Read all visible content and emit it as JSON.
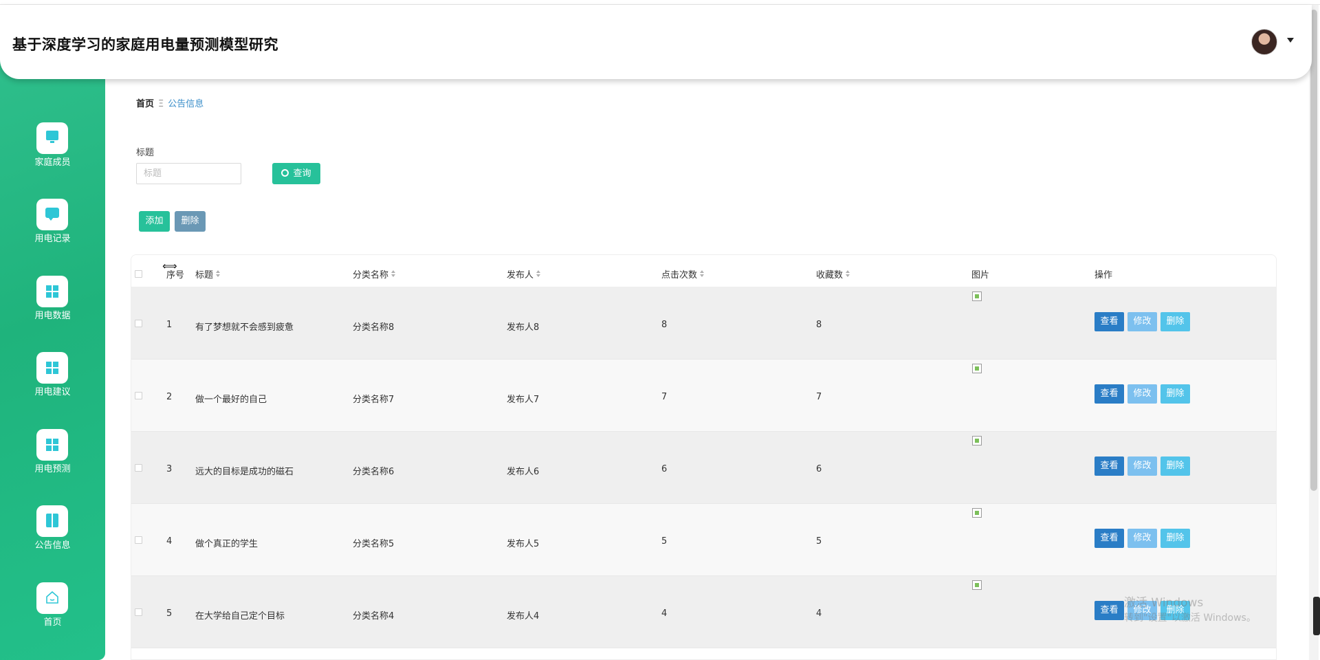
{
  "app": {
    "title": "基于深度学习的家庭用电量预测模型研究"
  },
  "sidebar": {
    "items": [
      {
        "label": "家庭成员",
        "icon": "monitor-icon"
      },
      {
        "label": "用电记录",
        "icon": "chat-icon"
      },
      {
        "label": "用电数据",
        "icon": "grid-icon"
      },
      {
        "label": "用电建议",
        "icon": "grid-icon"
      },
      {
        "label": "用电预测",
        "icon": "grid-icon"
      },
      {
        "label": "公告信息",
        "icon": "book-icon"
      },
      {
        "label": "首页",
        "icon": "home-icon"
      }
    ]
  },
  "breadcrumb": {
    "home": "首页",
    "separator": "Ξ",
    "current": "公告信息"
  },
  "search": {
    "label": "标题",
    "placeholder": "标题",
    "value": "",
    "button": "查询"
  },
  "actions": {
    "add": "添加",
    "delete": "删除"
  },
  "table": {
    "headers": {
      "index": "序号",
      "title": "标题",
      "category": "分类名称",
      "publisher": "发布人",
      "clicks": "点击次数",
      "favorites": "收藏数",
      "image": "图片",
      "ops": "操作"
    },
    "ops": {
      "view": "查看",
      "edit": "修改",
      "delete": "删除"
    },
    "rows": [
      {
        "index": "1",
        "title": "有了梦想就不会感到疲惫",
        "category": "分类名称8",
        "publisher": "发布人8",
        "clicks": "8",
        "favorites": "8"
      },
      {
        "index": "2",
        "title": "做一个最好的自己",
        "category": "分类名称7",
        "publisher": "发布人7",
        "clicks": "7",
        "favorites": "7"
      },
      {
        "index": "3",
        "title": "远大的目标是成功的磁石",
        "category": "分类名称6",
        "publisher": "发布人6",
        "clicks": "6",
        "favorites": "6"
      },
      {
        "index": "4",
        "title": "做个真正的学生",
        "category": "分类名称5",
        "publisher": "发布人5",
        "clicks": "5",
        "favorites": "5"
      },
      {
        "index": "5",
        "title": "在大学给自己定个目标",
        "category": "分类名称4",
        "publisher": "发布人4",
        "clicks": "4",
        "favorites": "4"
      }
    ]
  },
  "watermark": {
    "line1": "激活 Windows",
    "line2": "转到\"设置\"以激活 Windows。"
  },
  "colors": {
    "sidebar": "#1fb37c",
    "primary": "#27c19a",
    "view": "#2a7dc6",
    "edit": "#7cc0ef",
    "danger": "#53c4ea"
  }
}
